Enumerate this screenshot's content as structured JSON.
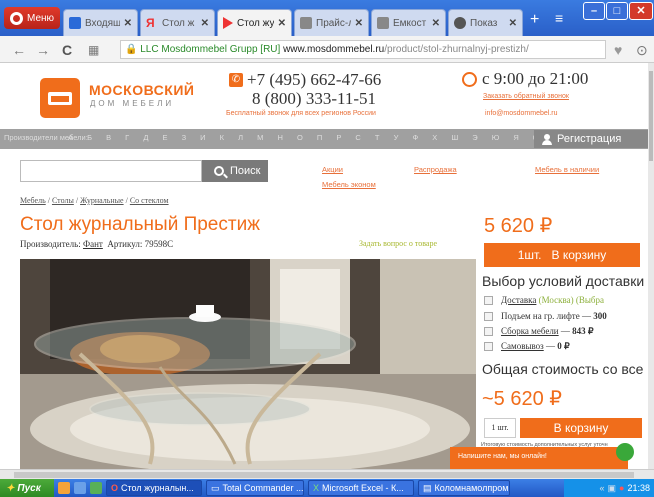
{
  "browser": {
    "menu_label": "Меню",
    "tabs": [
      {
        "label": "Входящ",
        "icon": "mail-icon"
      },
      {
        "label": "Стол ж",
        "icon": "yandex-icon"
      },
      {
        "label": "Стол жу",
        "icon": "youtube-icon",
        "active": true
      },
      {
        "label": "Прайс-л",
        "icon": "page-icon"
      },
      {
        "label": "Емкост",
        "icon": "page-icon"
      },
      {
        "label": "Показ",
        "icon": "page-icon"
      }
    ],
    "url_org": "LLC Mosdommebel Grupp [RU]",
    "url_host": "www.mosdommebel.ru",
    "url_path": "/product/stol-zhurnalnyj-prestizh/"
  },
  "header": {
    "brand_line1": "МОСКОВСКИЙ",
    "brand_line2": "ДОМ МЕБЕЛИ",
    "phone1": "+7 (495) 662-47-66",
    "phone2": "8 (800) 333-11-51",
    "free_call": "Бесплатный звонок для всех регионов России",
    "hours": "с 9:00 до 21:00",
    "callback": "Заказать обратный звонок",
    "email": "info@mosdommebel.ru"
  },
  "alphabet": {
    "prefix": "Производители мебели:",
    "letters": "А Б В Г Д Е З И К Л М Н О П Р С Т У Ф Х Ш Э Ю Я 0-9 A-Z",
    "register": "Регистрация"
  },
  "search": {
    "placeholder": "",
    "button": "Поиск"
  },
  "top_links": {
    "sales": "Акции",
    "clearance": "Распродажа",
    "in_stock": "Мебель в наличии",
    "cheap": "Мебель эконом"
  },
  "breadcrumbs": [
    "Мебель",
    "Столы",
    "Журнальные",
    "Со стеклом"
  ],
  "product": {
    "title": "Стол журнальный Престиж",
    "maker_label": "Производитель:",
    "maker": "Фант",
    "article_label": "Артикул:",
    "article": "79598С",
    "ask": "Задать вопрос о товаре",
    "price": "5 620 ₽",
    "cart_qty": "1шт.",
    "cart_label": "В корзину"
  },
  "delivery": {
    "title": "Выбор условий доставки",
    "options": [
      {
        "name": "Доставка",
        "extra": "(Москва) (Выбра"
      },
      {
        "name": "Подъем на гр. лифте",
        "value": "300"
      },
      {
        "name": "Сборка мебели",
        "value": "843 ₽"
      },
      {
        "name": "Самовывоз",
        "value": "0 ₽"
      }
    ]
  },
  "total": {
    "title": "Общая стоимость со все",
    "price": "~5 620 ₽",
    "qty": "1 шт.",
    "cart_label": "В корзину",
    "note": "Итоговую стоимость дополнительных услуг уточн"
  },
  "chat": {
    "text": "Напишите нам, мы онлайн!"
  },
  "taskbar": {
    "start": "Пуск",
    "tasks": [
      {
        "label": "Стол журналын...",
        "active": true
      },
      {
        "label": "Total Commander ..."
      },
      {
        "label": "Microsoft Excel - К..."
      },
      {
        "label": "Коломнамолпром..."
      }
    ],
    "time": "21:38"
  },
  "colors": {
    "accent": "#f06d1b",
    "green": "#8db03c",
    "alphabet_bar": "#a0a0a0"
  }
}
